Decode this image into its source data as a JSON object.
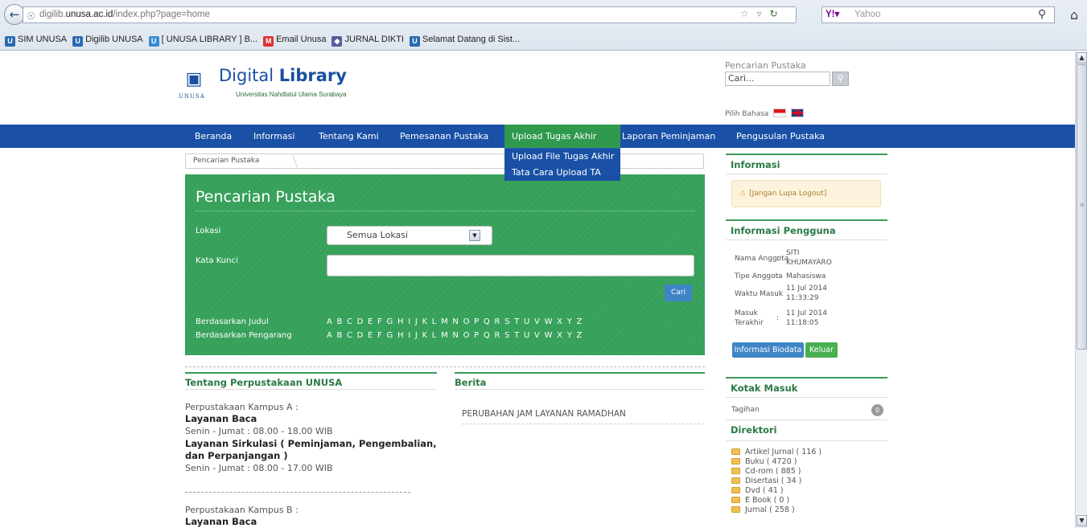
{
  "browser": {
    "url_prefix": "digilib.",
    "url_host": "unusa.ac.id",
    "url_path": "/index.php?page=home",
    "search_engine": "Yahoo",
    "bookmarks": [
      {
        "label": "SIM UNUSA",
        "icon": "unusa-icon",
        "color": "#2a6ab0"
      },
      {
        "label": "Digilib UNUSA",
        "icon": "unusa-icon",
        "color": "#2a6ab0"
      },
      {
        "label": "[ UNUSA LIBRARY ] B...",
        "icon": "library-icon",
        "color": "#3a8ad0"
      },
      {
        "label": "Email Unusa",
        "icon": "gmail-icon",
        "color": "#d33"
      },
      {
        "label": "JURNAL DIKTI",
        "icon": "dikti-icon",
        "color": "#5a5a9a"
      },
      {
        "label": "Selamat Datang di Sist...",
        "icon": "unusa-icon",
        "color": "#2a6ab0"
      }
    ]
  },
  "header": {
    "logo_text": "UNUSA",
    "title_light": "Digital ",
    "title_bold": "Library",
    "subtitle": "Universitas Nahdlatul Ulama Surabaya",
    "search_label": "Pencarian Pustaka",
    "search_placeholder": "Cari...",
    "language_label": "Pilih Bahasa"
  },
  "nav": {
    "items": [
      "Beranda",
      "Informasi",
      "Tentang Kami",
      "Pemesanan Pustaka",
      "Upload Tugas Akhir",
      "Laporan Peminjaman",
      "Pengusulan Pustaka"
    ],
    "dropdown": [
      "Upload File Tugas Akhir",
      "Tata Cara Upload TA"
    ]
  },
  "breadcrumb": "Pencarian Pustaka",
  "search_panel": {
    "title": "Pencarian Pustaka",
    "lokasi_label": "Lokasi",
    "lokasi_value": "Semua Lokasi",
    "kata_kunci_label": "Kata Kunci",
    "cari_label": "Cari",
    "by_title_label": "Berdasarkan Judul",
    "by_author_label": "Berdasarkan Pengarang",
    "letters": "ABCDEFGHIJKLMNOPQRSTUVWXYZ"
  },
  "tentang": {
    "heading": "Tentang Perpustakaan UNUSA",
    "kampus_a": "Perpustakaan Kampus A :",
    "layanan_baca": "Layanan Baca",
    "jam_baca": "Senin - Jumat : 08.00 - 18.00 WIB",
    "layanan_sirkulasi_1": "Layanan Sirkulasi ( Peminjaman, Pengembalian,",
    "layanan_sirkulasi_2": "dan Perpanjangan )",
    "jam_sirkulasi": "Senin - Jumat : 08.00 - 17.00 WIB",
    "kampus_b": "Perpustakaan Kampus B :",
    "layanan_baca_b": "Layanan Baca"
  },
  "berita": {
    "heading": "Berita",
    "items": [
      "PERUBAHAN JAM LAYANAN RAMADHAN"
    ]
  },
  "sidebar": {
    "informasi_heading": "Informasi",
    "alert": "[Jangan Lupa Logout]",
    "pengguna_heading": "Informasi Pengguna",
    "fields": [
      {
        "label": "Nama Anggota",
        "value_1": "SITI",
        "value_2": "KHUMAYARO"
      },
      {
        "label": "Tipe Anggota",
        "value_1": "Mahasiswa",
        "value_2": ""
      },
      {
        "label": "Waktu Masuk",
        "value_1": "11 Jul 2014",
        "value_2": "11:33:29"
      },
      {
        "label": "Masuk",
        "label_2": "Terakhir",
        "value_1": "11 Jul 2014",
        "value_2": "11:18:05"
      }
    ],
    "biodata_btn": "Informasi Biodata",
    "keluar_btn": "Keluar",
    "kotak_heading": "Kotak Masuk",
    "tagihan_label": "Tagihan",
    "tagihan_count": "0",
    "direktori_heading": "Direktori",
    "direktori": [
      "Artikel Jurnal ( 116 )",
      "Buku ( 4720 )",
      "Cd-rom ( 885 )",
      "Disertasi ( 34 )",
      "Dvd ( 41 )",
      "E Book ( 0 )",
      "Jurnal ( 258 )"
    ]
  }
}
